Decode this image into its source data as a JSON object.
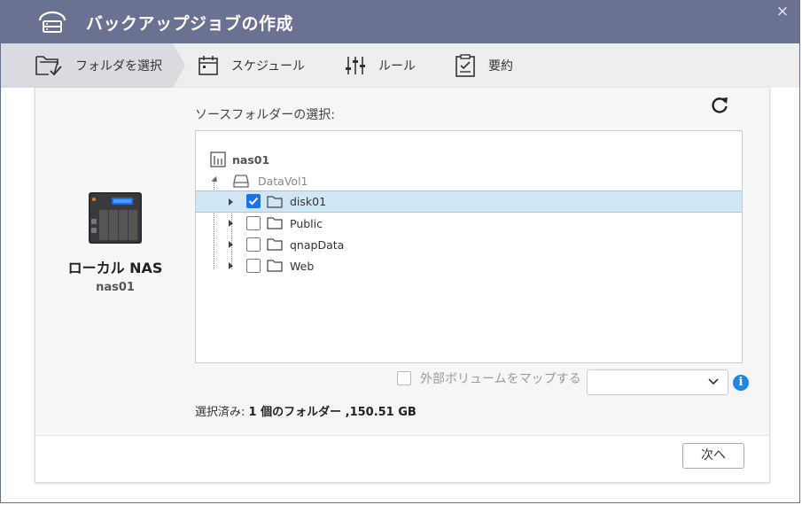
{
  "window": {
    "title": "バックアップジョブの作成",
    "close_glyph": "×",
    "icons": {
      "title": "backup-drive-icon",
      "close": "close-icon"
    }
  },
  "steps": [
    {
      "label": "フォルダを選択",
      "icon": "folder-check-icon",
      "active": true
    },
    {
      "label": "スケジュール",
      "icon": "calendar-icon",
      "active": false
    },
    {
      "label": "ルール",
      "icon": "sliders-icon",
      "active": false
    },
    {
      "label": "要約",
      "icon": "clipboard-icon",
      "active": false
    }
  ],
  "source": {
    "device_name": "ローカル NAS",
    "hostname": "nas01",
    "device_icon": "nas-device-icon"
  },
  "folder_picker": {
    "label": "ソースフォルダーの選択:",
    "refresh_icon": "refresh-icon",
    "tree": {
      "root": {
        "label": "nas01",
        "icon": "nas-server-icon"
      },
      "volume": {
        "label": "DataVol1",
        "icon": "hard-drive-icon"
      },
      "folders": [
        {
          "label": "disk01",
          "checked": true,
          "selected": true
        },
        {
          "label": "Public",
          "checked": false,
          "selected": false
        },
        {
          "label": "qnapData",
          "checked": false,
          "selected": false
        },
        {
          "label": "Web",
          "checked": false,
          "selected": false
        }
      ]
    }
  },
  "external_volume": {
    "label": "外部ボリュームをマップする",
    "checked": false,
    "select_value": "",
    "info_icon": "info-icon",
    "info_glyph": "i"
  },
  "selection_summary": {
    "prefix": "選択済み:",
    "detail": "1 個のフォルダー ,150.51 GB"
  },
  "footer": {
    "next_label": "次へ"
  },
  "colors": {
    "titlebar": "#6a7191",
    "accent": "#1a73e8",
    "selected_row": "#cfe6f7",
    "info": "#1e88e5"
  }
}
